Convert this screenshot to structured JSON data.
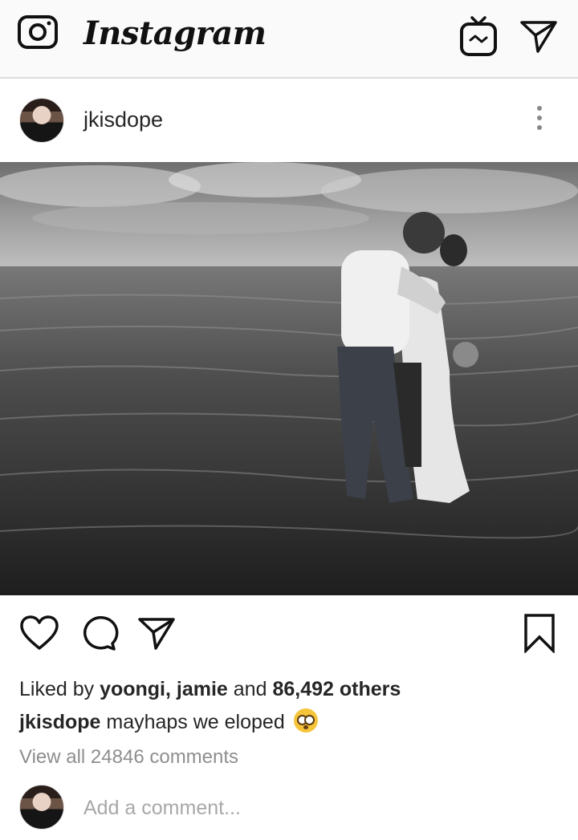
{
  "topbar": {
    "logo_text": "Instagram",
    "camera_icon": "camera-icon",
    "igtv_icon": "igtv-icon",
    "direct_icon": "paper-plane-icon"
  },
  "post": {
    "username": "jkisdope",
    "more_icon": "more-vertical-icon",
    "image_description_icon": "photo",
    "actions": {
      "like_icon": "heart-icon",
      "comment_icon": "comment-bubble-icon",
      "share_icon": "paper-plane-icon",
      "save_icon": "bookmark-icon"
    },
    "likes": {
      "prefix": "Liked by ",
      "users": "yoongi, jamie",
      "middle": " and ",
      "count": "86,492 others"
    },
    "caption": {
      "username": "jkisdope",
      "text": " mayhaps we eloped ",
      "emoji": "flushed-face-emoji"
    },
    "view_comments": "View all 24846 comments",
    "add_comment_placeholder": "Add a comment..."
  },
  "colors": {
    "text_primary": "#262626",
    "text_secondary": "#8e8e8e",
    "topbar_bg": "#fafafa",
    "divider": "#dbdbdb"
  }
}
